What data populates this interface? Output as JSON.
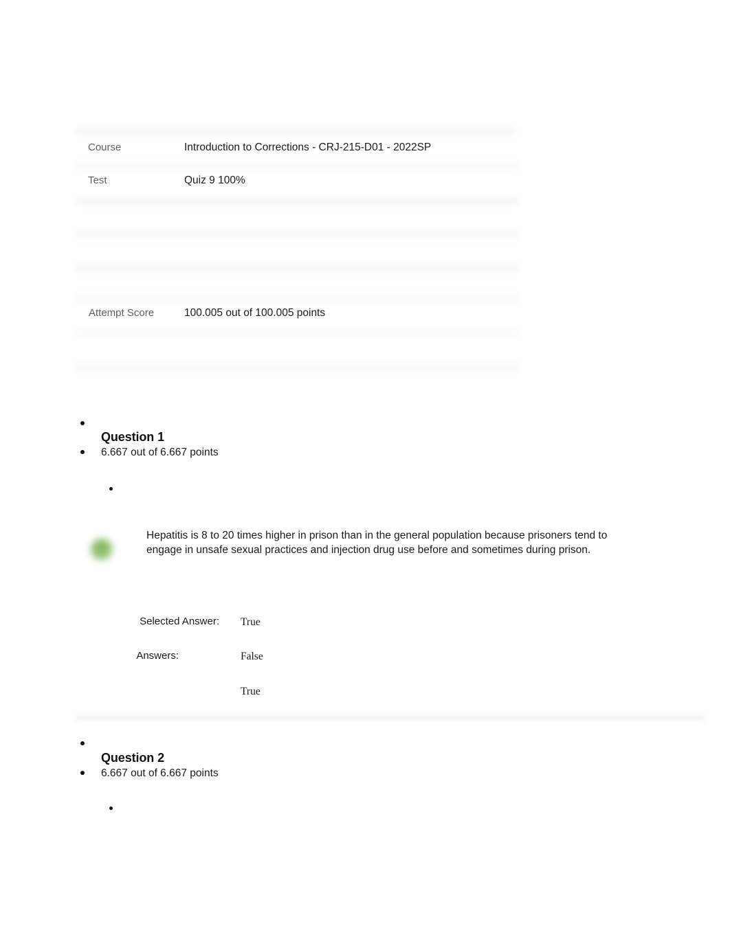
{
  "document": {
    "type": "quiz-review",
    "background_color": "#ffffff",
    "text_color": "#1a1a1a",
    "label_color": "#5e5e5e",
    "correct_marker_color": "#7fb85c"
  },
  "header": {
    "rows": [
      {
        "label": "Course",
        "value": "Introduction to Corrections - CRJ-215-D01 - 2022SP"
      },
      {
        "label": "Test",
        "value": "Quiz 9 100%"
      },
      {
        "label": "Attempt Score",
        "value": "100.005 out of 100.005 points"
      }
    ]
  },
  "questions": [
    {
      "title": "Question 1",
      "points": "6.667 out of 6.667 points",
      "correct_icon": "green-check-circle-icon",
      "text": "Hepatitis is 8 to 20 times higher in prison than in the general population because prisoners tend to engage in unsafe sexual practices and injection drug use before and sometimes during prison.",
      "selected_answer_label": "Selected Answer:",
      "selected_answer_value": "True",
      "answers_label": "Answers:",
      "answer_options": [
        "False",
        "True"
      ]
    },
    {
      "title": "Question 2",
      "points": "6.667 out of 6.667 points"
    }
  ]
}
